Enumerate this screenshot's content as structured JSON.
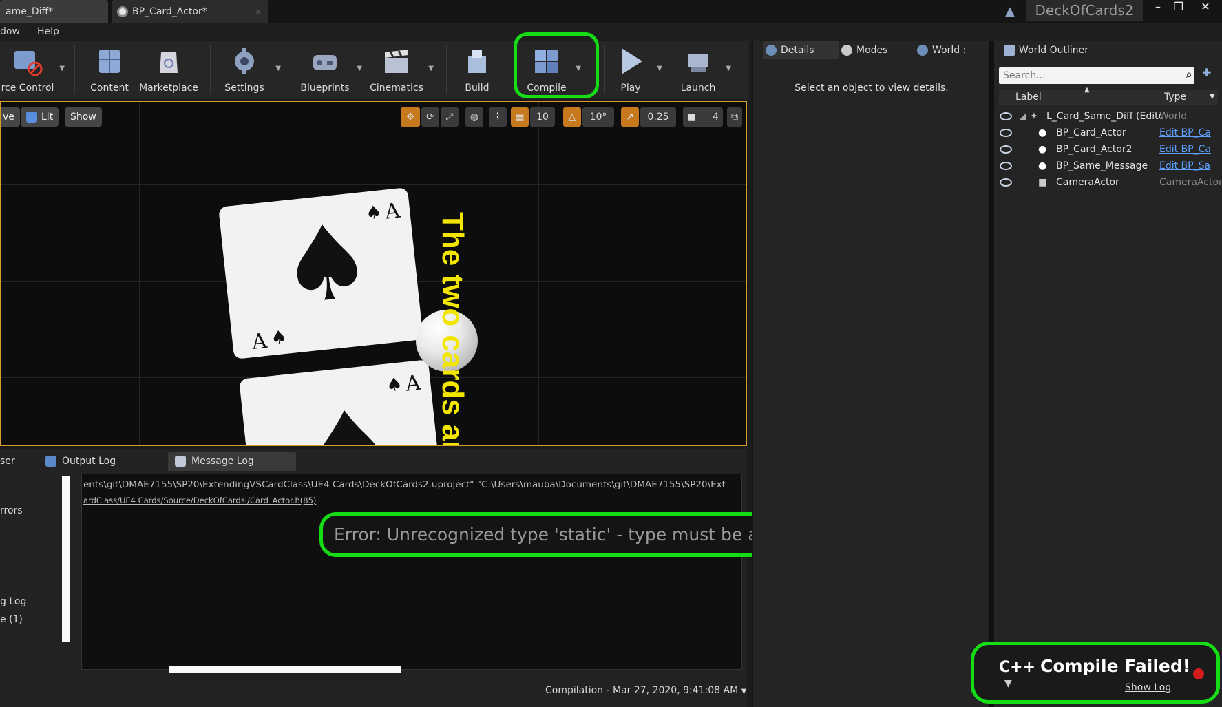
{
  "tabs": [
    {
      "label": "ame_Diff*"
    },
    {
      "label": "BP_Card_Actor*"
    }
  ],
  "app_title": "DeckOfCards2",
  "menu": {
    "items": [
      "dow",
      "Help"
    ]
  },
  "toolbar": {
    "items": [
      {
        "label": "rce Control",
        "icon": "source-control-icon"
      },
      {
        "label": "Content",
        "icon": "content-icon"
      },
      {
        "label": "Marketplace",
        "icon": "marketplace-icon"
      },
      {
        "label": "Settings",
        "icon": "settings-gear-icon"
      },
      {
        "label": "Blueprints",
        "icon": "blueprints-icon"
      },
      {
        "label": "Cinematics",
        "icon": "cinematics-clapper-icon"
      },
      {
        "label": "Build",
        "icon": "build-icon"
      },
      {
        "label": "Compile",
        "icon": "compile-cubes-icon"
      },
      {
        "label": "Play",
        "icon": "play-icon"
      },
      {
        "label": "Launch",
        "icon": "launch-icon"
      }
    ]
  },
  "viewport": {
    "left_buttons": [
      "ve",
      "Lit",
      "Show"
    ],
    "grid_snap": "10",
    "rot_snap": "10°",
    "scale_snap": "0.25",
    "camera_speed": "4",
    "overlay_text": "The two cards are"
  },
  "bottom": {
    "tabs": [
      "ser",
      "Output Log",
      "Message Log"
    ],
    "left_items": [
      "rrors",
      "g Log",
      "e (1)"
    ],
    "log_lines": [
      "ents\\git\\DMAE7155\\SP20\\ExtendingVSCardClass\\UE4 Cards\\DeckOfCards2.uproject\" \"C:\\Users\\mauba\\Documents\\git\\DMAE7155\\SP20\\Ext",
      "ardClass/UE4 Cards/Source/DeckOfCardsI/Card_Actor.h(85)"
    ],
    "error_text": "Error: Unrecognized type 'static' - type must be a UCLASS, USTRUCT or UENUM",
    "compilation": "Compilation - Mar 27, 2020, 9:41:08 AM"
  },
  "details": {
    "tabs": [
      "Details",
      "Modes",
      "World :"
    ],
    "message": "Select an object to view details."
  },
  "outliner": {
    "title": "World Outliner",
    "search_placeholder": "Search...",
    "col_label": "Label",
    "col_type": "Type",
    "rows": [
      {
        "label": "L_Card_Same_Diff (Editc",
        "type": "World"
      },
      {
        "label": "BP_Card_Actor",
        "type": "Edit BP_Ca"
      },
      {
        "label": "BP_Card_Actor2",
        "type": "Edit BP_Ca"
      },
      {
        "label": "BP_Same_Message",
        "type": "Edit BP_Sa"
      },
      {
        "label": "CameraActor",
        "type": "CameraActoı"
      }
    ]
  },
  "toast": {
    "cpp": "C++",
    "title": "Compile Failed!",
    "link": "Show Log"
  },
  "colors": {
    "highlight": "#16dc16",
    "accent_orange": "#c67a1d",
    "link": "#5ea2ff",
    "overlay_yellow": "#f2e600"
  }
}
